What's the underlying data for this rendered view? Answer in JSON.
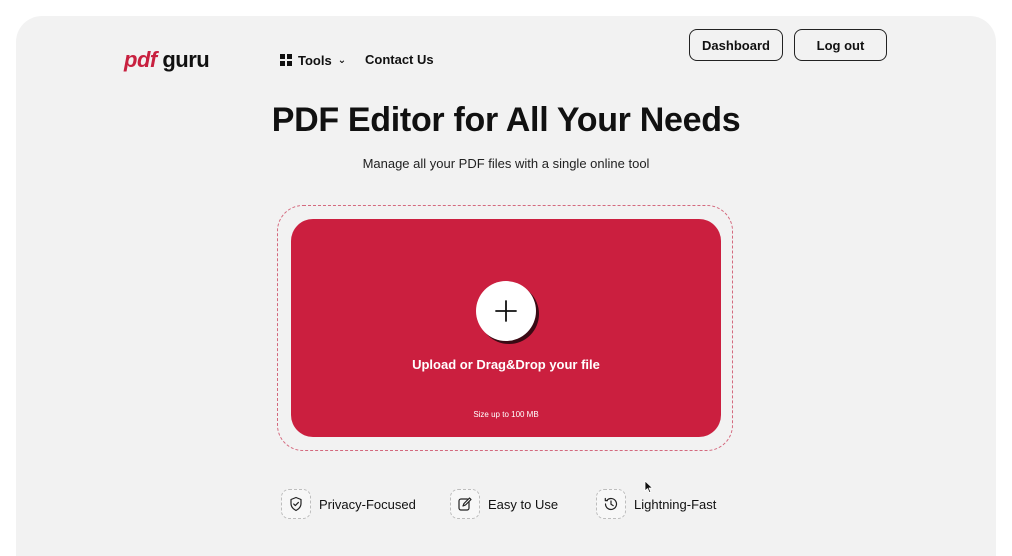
{
  "header": {
    "logo_pdf": "pdf",
    "logo_guru": "guru",
    "nav_tools": "Tools",
    "nav_contact": "Contact Us",
    "dashboard_label": "Dashboard",
    "logout_label": "Log out"
  },
  "hero": {
    "title": "PDF Editor for All Your Needs",
    "subtitle": "Manage all your PDF files with a single online tool"
  },
  "upload": {
    "label": "Upload or Drag&Drop your file",
    "size_note": "Size up to 100 MB",
    "plus_icon": "plus-icon"
  },
  "features": [
    {
      "label": "Privacy-Focused",
      "icon": "shield-check-icon"
    },
    {
      "label": "Easy to Use",
      "icon": "edit-icon"
    },
    {
      "label": "Lightning-Fast",
      "icon": "clock-icon"
    }
  ],
  "colors": {
    "brand": "#cb1f3f",
    "background": "#f2f2f2"
  }
}
